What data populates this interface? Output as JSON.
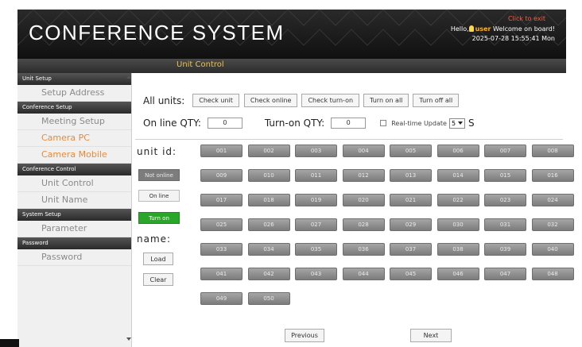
{
  "header": {
    "title": "CONFERENCE SYSTEM",
    "exit_link": "Click to exit",
    "greeting_prefix": "Hello,",
    "user_name": "user",
    "greeting_suffix": "Welcome on board!",
    "datetime": "2025-07-28 15:55:41 Mon"
  },
  "section_title": "Unit Control",
  "sidebar": {
    "groups": [
      {
        "title": "Unit Setup",
        "items": [
          {
            "label": "Setup Address",
            "active": false
          }
        ]
      },
      {
        "title": "Conference Setup",
        "items": [
          {
            "label": "Meeting Setup",
            "active": false
          },
          {
            "label": "Camera PC",
            "active": true
          },
          {
            "label": "Camera Mobile",
            "active": true
          }
        ]
      },
      {
        "title": "Conference Control",
        "items": [
          {
            "label": "Unit Control",
            "active": false
          },
          {
            "label": "Unit Name",
            "active": false
          }
        ]
      },
      {
        "title": "System Setup",
        "items": [
          {
            "label": "Parameter",
            "active": false
          }
        ]
      },
      {
        "title": "Password",
        "items": [
          {
            "label": "Password",
            "active": false
          }
        ]
      }
    ]
  },
  "toolbar": {
    "all_units_label": "All units:",
    "check_unit": "Check unit",
    "check_online": "Check online",
    "check_turn_on": "Check turn-on",
    "turn_on_all": "Turn on all",
    "turn_off_all": "Turn off all",
    "online_qty_label": "On line QTY:",
    "online_qty_value": "0",
    "turnon_qty_label": "Turn-on QTY:",
    "turnon_qty_value": "0",
    "realtime_label": "Real-time Update",
    "interval_value": "5",
    "interval_unit": "S"
  },
  "left_panel": {
    "unit_id_label": "unit id:",
    "legend_not_online": "Not online",
    "legend_on_line": "On line",
    "legend_turn_on": "Turn on",
    "name_label": "name:",
    "load_button": "Load",
    "clear_button": "Clear"
  },
  "units": [
    "001",
    "002",
    "003",
    "004",
    "005",
    "006",
    "007",
    "008",
    "009",
    "010",
    "011",
    "012",
    "013",
    "014",
    "015",
    "016",
    "017",
    "018",
    "019",
    "020",
    "021",
    "022",
    "023",
    "024",
    "025",
    "026",
    "027",
    "028",
    "029",
    "030",
    "031",
    "032",
    "033",
    "034",
    "035",
    "036",
    "037",
    "038",
    "039",
    "040",
    "041",
    "042",
    "043",
    "044",
    "045",
    "046",
    "047",
    "048",
    "049",
    "050"
  ],
  "pagination": {
    "previous": "Previous",
    "next": "Next"
  },
  "colors": {
    "not_online": "#7d7d7d",
    "turn_on": "#2aa62a",
    "accent": "#e88a3a",
    "header_bg": "#1a1a1a"
  }
}
